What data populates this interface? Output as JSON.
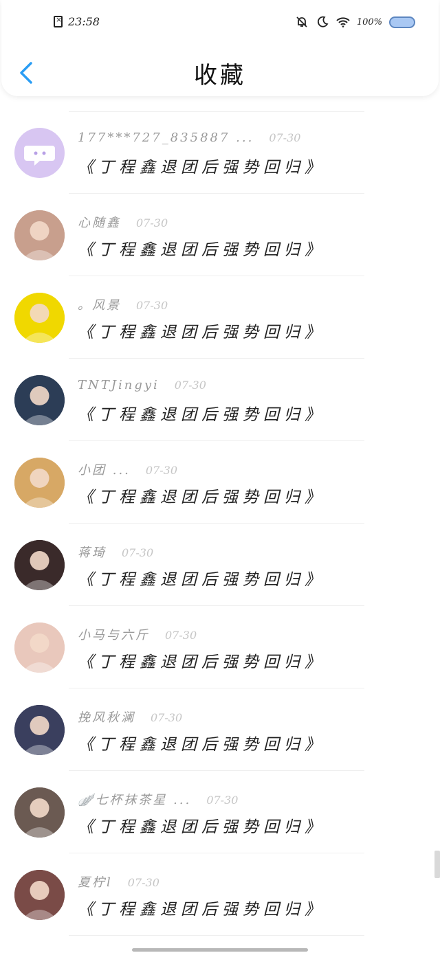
{
  "status_bar": {
    "time": "23:58",
    "battery_percent": "100%",
    "icons": [
      "sim-error-icon",
      "bell-off-icon",
      "moon-icon",
      "wifi-icon",
      "battery-icon"
    ]
  },
  "header": {
    "title": "收藏",
    "back_icon": "chevron-left-icon"
  },
  "items": [
    {
      "user": "177***727_835887 ...",
      "date": "07-30",
      "title": "《丁程鑫退团后强势回归》",
      "avatar_color": "#d8c6f2"
    },
    {
      "user": "心随鑫",
      "date": "07-30",
      "title": "《丁程鑫退团后强势回归》",
      "avatar_color": "#c89f8d"
    },
    {
      "user": "。风景",
      "date": "07-30",
      "title": "《丁程鑫退团后强势回归》",
      "avatar_color": "#f0d800"
    },
    {
      "user": "TNTJingyi",
      "date": "07-30",
      "title": "《丁程鑫退团后强势回归》",
      "avatar_color": "#2c3d56"
    },
    {
      "user": "小团 ...",
      "date": "07-30",
      "title": "《丁程鑫退团后强势回归》",
      "avatar_color": "#d7a865"
    },
    {
      "user": "蒋琦",
      "date": "07-30",
      "title": "《丁程鑫退团后强势回归》",
      "avatar_color": "#3a2a2a"
    },
    {
      "user": "小马与六斤",
      "date": "07-30",
      "title": "《丁程鑫退团后强势回归》",
      "avatar_color": "#e9c8bc"
    },
    {
      "user": "挽风秋澜",
      "date": "07-30",
      "title": "《丁程鑫退团后强势回归》",
      "avatar_color": "#3a3f5e"
    },
    {
      "user": "🪽七杯抹茶星 ...",
      "date": "07-30",
      "title": "《丁程鑫退团后强势回归》",
      "avatar_color": "#6b5a52"
    },
    {
      "user": "夏柠l",
      "date": "07-30",
      "title": "《丁程鑫退团后强势回归》",
      "avatar_color": "#7a4b47"
    }
  ],
  "colors": {
    "accent": "#2a9df4",
    "divider": "#efefef",
    "name_gray": "#9a9a9a",
    "date_gray": "#c6c6c6"
  }
}
